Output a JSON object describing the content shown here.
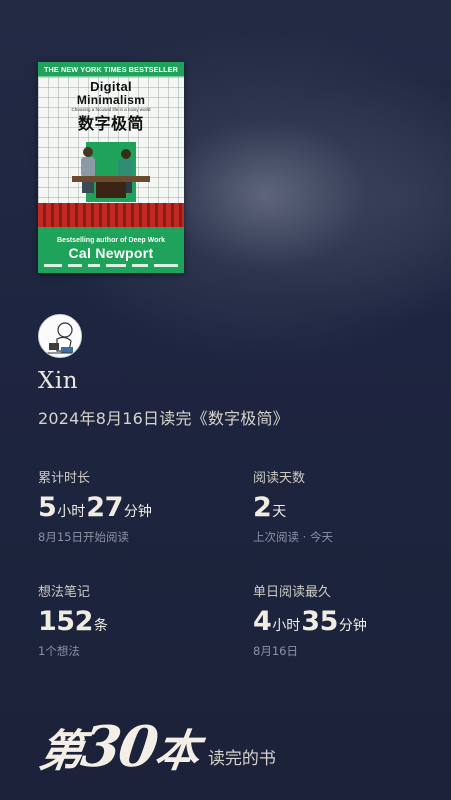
{
  "book": {
    "badge": "THE NEW YORK TIMES BESTSELLER",
    "title_line1": "Digital",
    "title_line2": "Minimalism",
    "tagline": "Choosing a focused life in a noisy world",
    "title_cn": "数字极简",
    "author_line": "Bestselling author of Deep Work",
    "author": "Cal Newport",
    "accent_color": "#1fa35b"
  },
  "user": {
    "avatar_icon": "cartoon-avatar-icon",
    "name": "Xin"
  },
  "finish_line": "2024年8月16日读完《数字极简》",
  "stats": {
    "total_time": {
      "label": "累计时长",
      "hours": "5",
      "hours_unit": "小时",
      "minutes": "27",
      "minutes_unit": "分钟",
      "sub": "8月15日开始阅读"
    },
    "reading_days": {
      "label": "阅读天数",
      "value": "2",
      "unit": "天",
      "sub": "上次阅读 · 今天"
    },
    "notes": {
      "label": "想法笔记",
      "value": "152",
      "unit": "条",
      "sub": "1个想法"
    },
    "longest_day": {
      "label": "单日阅读最久",
      "hours": "4",
      "hours_unit": "小时",
      "minutes": "35",
      "minutes_unit": "分钟",
      "sub": "8月16日"
    }
  },
  "rank": {
    "prefix": "第",
    "number": "30",
    "suffix": "本",
    "caption": "读完的书"
  }
}
